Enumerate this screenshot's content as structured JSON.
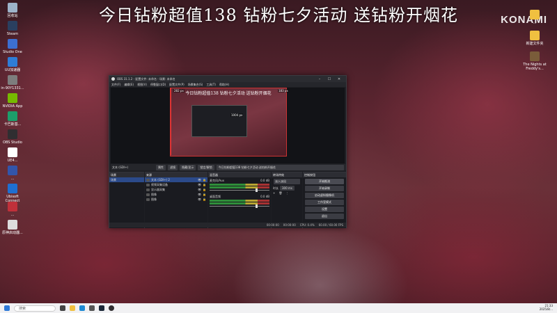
{
  "banner": {
    "text": "今日钻粉超值138 钻粉七夕活动 送钻粉开烟花",
    "logo": "KONAMI"
  },
  "desktop_icons_left": [
    {
      "label": "回收站",
      "icon": "recycle-bin-icon",
      "color": "#9db3c9"
    },
    {
      "label": "Steam",
      "icon": "steam-icon",
      "color": "#2a3f5f"
    },
    {
      "label": "Studio One",
      "icon": "studio-one-icon",
      "color": "#3c6fd1"
    },
    {
      "label": "UU加速器",
      "icon": "uu-icon",
      "color": "#2e7dd7"
    },
    {
      "label": "in-90Y1331...",
      "icon": "file-icon",
      "color": "#7d7d7d"
    },
    {
      "label": "NVIDIA App",
      "icon": "nvidia-icon",
      "color": "#76b900"
    },
    {
      "label": "卡巴斯基...",
      "icon": "app-icon",
      "color": "#1c9e6b"
    },
    {
      "label": "OBS Studio",
      "icon": "obs-icon",
      "color": "#302e31"
    },
    {
      "label": "UE4...",
      "icon": "app-icon",
      "color": "#ffffff"
    },
    {
      "label": "...",
      "icon": "app-icon",
      "color": "#3355aa"
    },
    {
      "label": "Ubisoft Connect",
      "icon": "ubisoft-icon",
      "color": "#1f6fd1"
    },
    {
      "label": "...",
      "icon": "app-icon",
      "color": "#c0303a"
    },
    {
      "label": "原神启动器...",
      "icon": "shortcut-icon",
      "color": "#dddddd"
    }
  ],
  "desktop_icons_right": [
    {
      "label": "...",
      "icon": "folder-icon",
      "color": "#f0c040"
    },
    {
      "label": "新建文件夹",
      "icon": "folder-icon",
      "color": "#f0c040"
    },
    {
      "label": "The Nights at Freddy's...",
      "icon": "game-icon",
      "color": "#7a5c3a"
    }
  ],
  "obs": {
    "title": "OBS 31.1.2 - 配置文件: 未命名 - 场景: 未命名",
    "menu": [
      "文件(F)",
      "编辑(E)",
      "视图(V)",
      "停靠窗口(D)",
      "配置文件(P)",
      "场景集合(S)",
      "工具(T)",
      "帮助(H)"
    ],
    "preview_banner": "今日钻粉超值138 钻粉七夕活动 送钻粉开烟花",
    "size_label_top_left": "282 px",
    "size_label_top_right": "183 px",
    "size_label_mid": "1004 px",
    "source_bar": {
      "source_name": "文本 (GDI+)",
      "buttons": [
        "属性",
        "滤镜",
        "隐藏/显示",
        "锁定/解锁"
      ],
      "text_value": "今日钻粉超值138 钻粉七夕活动 送钻粉开烟花"
    },
    "scenes": {
      "header": "场景",
      "items": [
        "场景"
      ]
    },
    "sources": {
      "header": "来源",
      "items": [
        "文本 (GDI+) 2",
        "视频采集设备",
        "显示器采集",
        "图像",
        "图像"
      ]
    },
    "mixer": {
      "header": "混音器",
      "tracks": [
        {
          "name": "麦克风/Aux",
          "db": "0.0 dB"
        },
        {
          "name": "桌面音频",
          "db": "0.0 dB"
        }
      ]
    },
    "transitions": {
      "header": "转场特效",
      "type": "淡入淡出",
      "duration_label": "时长",
      "duration": "300 ms"
    },
    "controls": {
      "header": "控制按钮",
      "buttons": [
        "开始推流",
        "开始录制",
        "启动虚拟摄像机",
        "工作室模式",
        "设置",
        "退出"
      ]
    },
    "status": {
      "stream_time": "00:00:00",
      "record_time": "00:00:00",
      "cpu": "CPU: 0.4%",
      "fps": "60.00 / 60.00 FPS"
    }
  },
  "taskbar": {
    "search_placeholder": "搜索",
    "time": "21:33",
    "date": "2025/8/..."
  }
}
